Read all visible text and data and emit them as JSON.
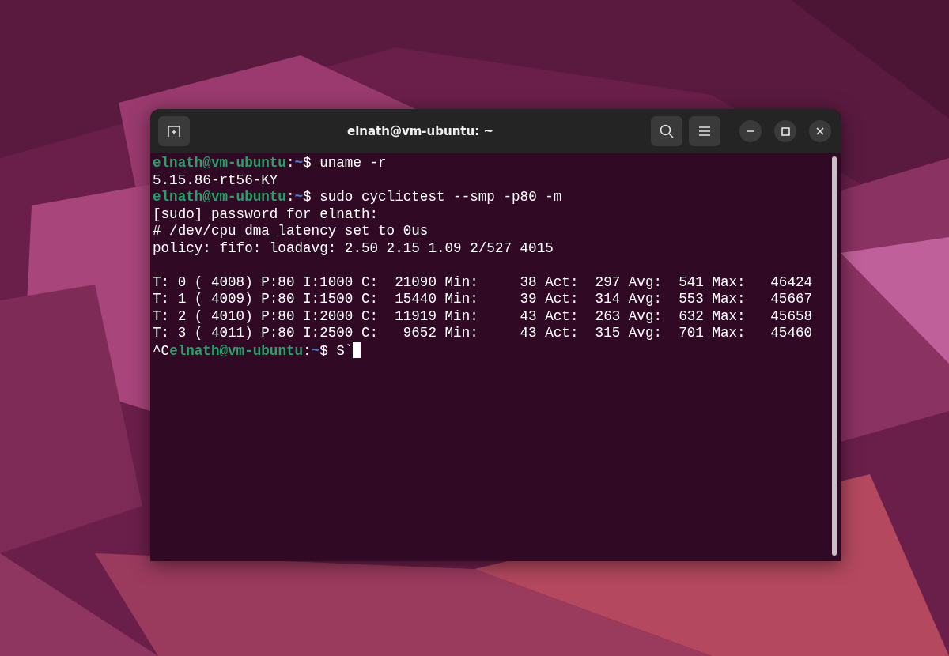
{
  "window": {
    "title": "elnath@vm-ubuntu: ~"
  },
  "terminal": {
    "lines": [
      {
        "kind": "prompt",
        "user": "elnath@vm-ubuntu",
        "separator": ":",
        "path": "~",
        "command": "$ uname -r"
      },
      {
        "kind": "output",
        "text": "5.15.86-rt56-KY"
      },
      {
        "kind": "prompt",
        "user": "elnath@vm-ubuntu",
        "separator": ":",
        "path": "~",
        "command": "$ sudo cyclictest --smp -p80 -m"
      },
      {
        "kind": "output",
        "text": "[sudo] password for elnath:"
      },
      {
        "kind": "output",
        "text": "# /dev/cpu_dma_latency set to 0us"
      },
      {
        "kind": "output",
        "text": "policy: fifo: loadavg: 2.50 2.15 1.09 2/527 4015"
      },
      {
        "kind": "blank"
      },
      {
        "kind": "output",
        "text": "T: 0 ( 4008) P:80 I:1000 C:  21090 Min:     38 Act:  297 Avg:  541 Max:   46424"
      },
      {
        "kind": "output",
        "text": "T: 1 ( 4009) P:80 I:1500 C:  15440 Min:     39 Act:  314 Avg:  553 Max:   45667"
      },
      {
        "kind": "output",
        "text": "T: 2 ( 4010) P:80 I:2000 C:  11919 Min:     43 Act:  263 Avg:  632 Max:   45658"
      },
      {
        "kind": "output",
        "text": "T: 3 ( 4011) P:80 I:2500 C:   9652 Min:     43 Act:  315 Avg:  701 Max:   45460"
      },
      {
        "kind": "prompt",
        "prefix": "^C",
        "user": "elnath@vm-ubuntu",
        "separator": ":",
        "path": "~",
        "command": "$ S`",
        "cursor": true
      }
    ]
  }
}
